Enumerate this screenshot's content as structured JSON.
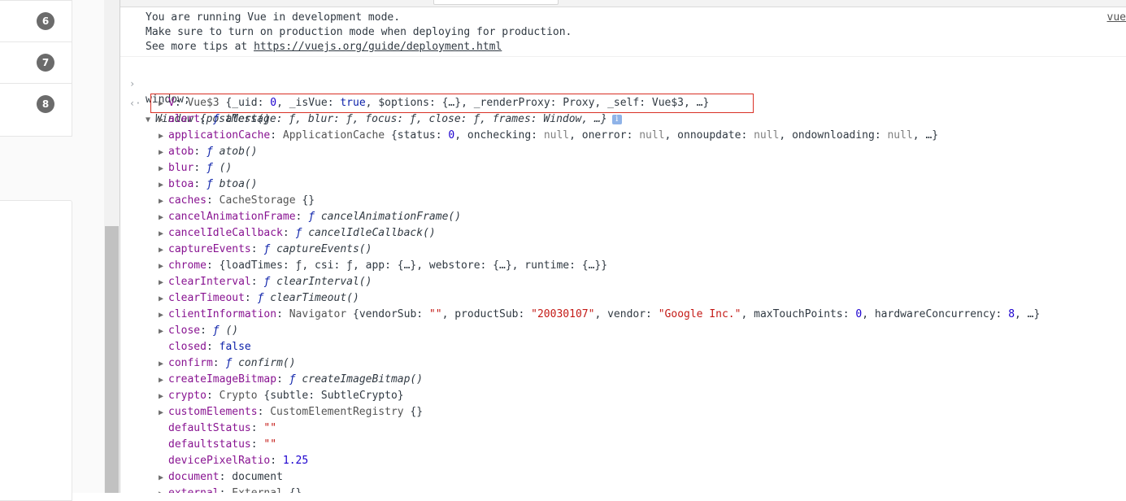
{
  "sidebar": {
    "badges": [
      "6",
      "7",
      "8"
    ]
  },
  "console": {
    "messages": [
      "You are running Vue in development mode.",
      "Make sure to turn on production mode when deploying for production.",
      "See more tips at "
    ],
    "tips_link": "https://vuejs.org/guide/deployment.html",
    "source_link": "vue",
    "input": "window;",
    "window_summary": "Window {postMessage: ƒ, blur: ƒ, focus: ƒ, close: ƒ, frames: Window, …}",
    "properties": [
      {
        "expand": true,
        "key": "V",
        "parts": [
          [
            "cls",
            "Vue$3 "
          ],
          [
            "p",
            "{_uid: "
          ],
          [
            "num",
            "0"
          ],
          [
            "p",
            ", _isVue: "
          ],
          [
            "kw",
            "true"
          ],
          [
            "p",
            ", $options: {…}, _renderProxy: Proxy, _self: Vue$3, …}"
          ]
        ]
      },
      {
        "expand": true,
        "key": "alert",
        "parts": [
          [
            "fsym",
            "ƒ "
          ],
          [
            "ital",
            "alert()"
          ]
        ]
      },
      {
        "expand": true,
        "key": "applicationCache",
        "parts": [
          [
            "cls",
            "ApplicationCache "
          ],
          [
            "p",
            "{status: "
          ],
          [
            "num",
            "0"
          ],
          [
            "p",
            ", onchecking: "
          ],
          [
            "nul",
            "null"
          ],
          [
            "p",
            ", onerror: "
          ],
          [
            "nul",
            "null"
          ],
          [
            "p",
            ", onnoupdate: "
          ],
          [
            "nul",
            "null"
          ],
          [
            "p",
            ", ondownloading: "
          ],
          [
            "nul",
            "null"
          ],
          [
            "p",
            ", …}"
          ]
        ]
      },
      {
        "expand": true,
        "key": "atob",
        "parts": [
          [
            "fsym",
            "ƒ "
          ],
          [
            "ital",
            "atob()"
          ]
        ]
      },
      {
        "expand": true,
        "key": "blur",
        "parts": [
          [
            "fsym",
            "ƒ "
          ],
          [
            "ital",
            "()"
          ]
        ]
      },
      {
        "expand": true,
        "key": "btoa",
        "parts": [
          [
            "fsym",
            "ƒ "
          ],
          [
            "ital",
            "btoa()"
          ]
        ]
      },
      {
        "expand": true,
        "key": "caches",
        "parts": [
          [
            "cls",
            "CacheStorage "
          ],
          [
            "p",
            "{}"
          ]
        ]
      },
      {
        "expand": true,
        "key": "cancelAnimationFrame",
        "parts": [
          [
            "fsym",
            "ƒ "
          ],
          [
            "ital",
            "cancelAnimationFrame()"
          ]
        ]
      },
      {
        "expand": true,
        "key": "cancelIdleCallback",
        "parts": [
          [
            "fsym",
            "ƒ "
          ],
          [
            "ital",
            "cancelIdleCallback()"
          ]
        ]
      },
      {
        "expand": true,
        "key": "captureEvents",
        "parts": [
          [
            "fsym",
            "ƒ "
          ],
          [
            "ital",
            "captureEvents()"
          ]
        ]
      },
      {
        "expand": true,
        "key": "chrome",
        "parts": [
          [
            "p",
            "{loadTimes: ƒ, csi: ƒ, app: {…}, webstore: {…}, runtime: {…}}"
          ]
        ]
      },
      {
        "expand": true,
        "key": "clearInterval",
        "parts": [
          [
            "fsym",
            "ƒ "
          ],
          [
            "ital",
            "clearInterval()"
          ]
        ]
      },
      {
        "expand": true,
        "key": "clearTimeout",
        "parts": [
          [
            "fsym",
            "ƒ "
          ],
          [
            "ital",
            "clearTimeout()"
          ]
        ]
      },
      {
        "expand": true,
        "key": "clientInformation",
        "parts": [
          [
            "cls",
            "Navigator "
          ],
          [
            "p",
            "{vendorSub: "
          ],
          [
            "str",
            "\"\""
          ],
          [
            "p",
            ", productSub: "
          ],
          [
            "str",
            "\"20030107\""
          ],
          [
            "p",
            ", vendor: "
          ],
          [
            "str",
            "\"Google Inc.\""
          ],
          [
            "p",
            ", maxTouchPoints: "
          ],
          [
            "num",
            "0"
          ],
          [
            "p",
            ", hardwareConcurrency: "
          ],
          [
            "num",
            "8"
          ],
          [
            "p",
            ", …}"
          ]
        ]
      },
      {
        "expand": true,
        "key": "close",
        "parts": [
          [
            "fsym",
            "ƒ "
          ],
          [
            "ital",
            "()"
          ]
        ]
      },
      {
        "expand": false,
        "key": "closed",
        "parts": [
          [
            "kw",
            "false"
          ]
        ]
      },
      {
        "expand": true,
        "key": "confirm",
        "parts": [
          [
            "fsym",
            "ƒ "
          ],
          [
            "ital",
            "confirm()"
          ]
        ]
      },
      {
        "expand": true,
        "key": "createImageBitmap",
        "parts": [
          [
            "fsym",
            "ƒ "
          ],
          [
            "ital",
            "createImageBitmap()"
          ]
        ]
      },
      {
        "expand": true,
        "key": "crypto",
        "parts": [
          [
            "cls",
            "Crypto "
          ],
          [
            "p",
            "{subtle: SubtleCrypto}"
          ]
        ]
      },
      {
        "expand": true,
        "key": "customElements",
        "parts": [
          [
            "cls",
            "CustomElementRegistry "
          ],
          [
            "p",
            "{}"
          ]
        ]
      },
      {
        "expand": false,
        "key": "defaultStatus",
        "parts": [
          [
            "str",
            "\"\""
          ]
        ]
      },
      {
        "expand": false,
        "key": "defaultstatus",
        "parts": [
          [
            "str",
            "\"\""
          ]
        ]
      },
      {
        "expand": false,
        "key": "devicePixelRatio",
        "parts": [
          [
            "num",
            "1.25"
          ]
        ]
      },
      {
        "expand": true,
        "key": "document",
        "parts": [
          [
            "p",
            "document"
          ]
        ]
      },
      {
        "expand": true,
        "key": "external",
        "parts": [
          [
            "cls",
            "External "
          ],
          [
            "p",
            "{}"
          ]
        ]
      }
    ]
  },
  "colors": {
    "highlight": "#d93025",
    "key": "#881391",
    "number": "#1c00cf",
    "string": "#c41a16"
  }
}
